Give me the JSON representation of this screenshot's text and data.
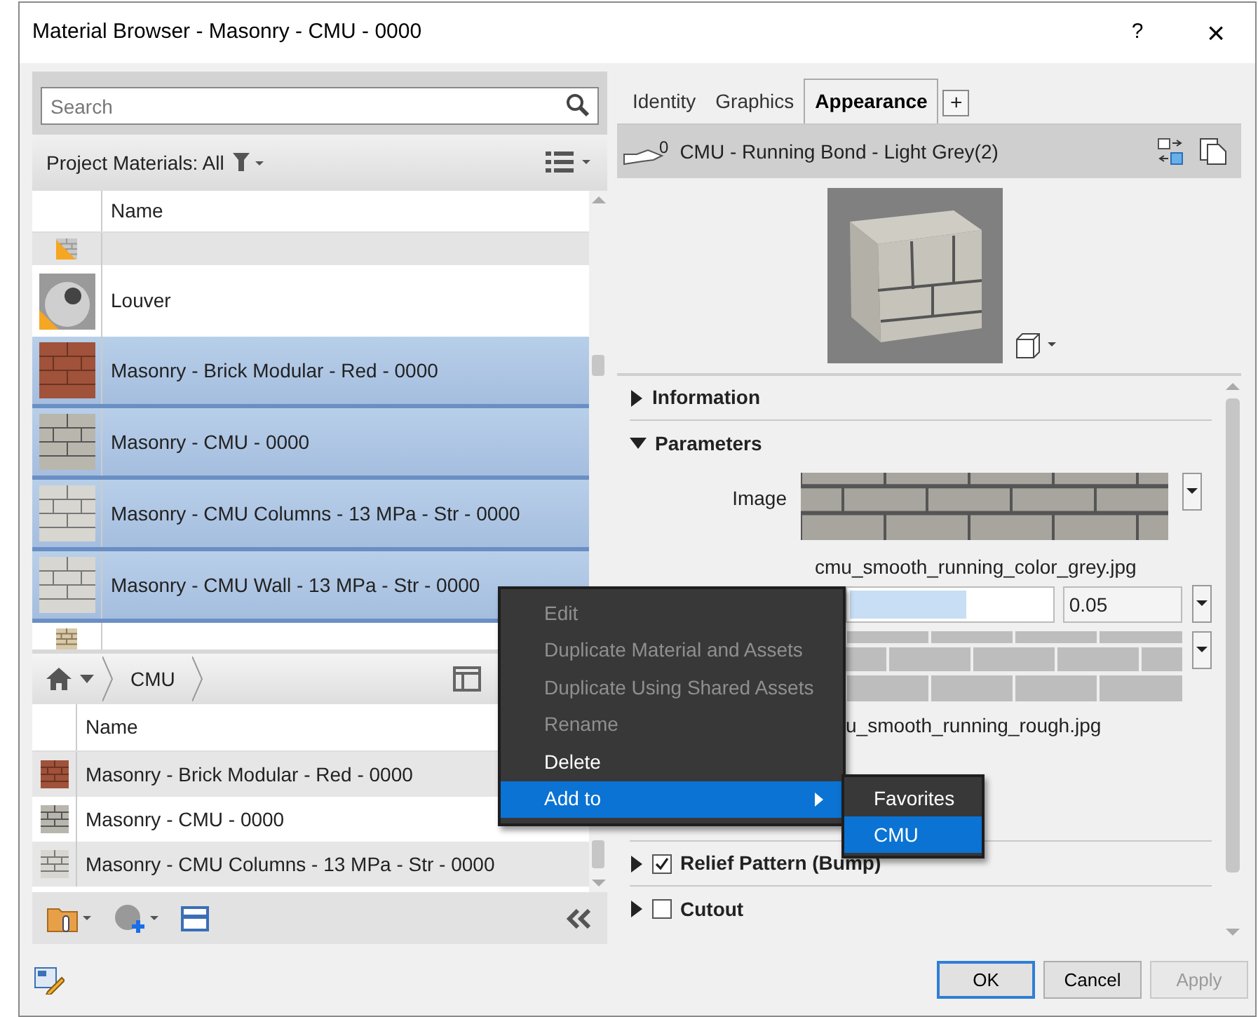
{
  "window": {
    "title": "Material Browser - Masonry - CMU - 0000",
    "help": "?",
    "close": "×"
  },
  "search": {
    "placeholder": "Search"
  },
  "filter": {
    "label": "Project Materials: All"
  },
  "project_list": {
    "columns": [
      "Name"
    ],
    "rows": [
      {
        "kind": "linoleum",
        "warning": true,
        "selected": false
      },
      {
        "name": "Louver",
        "kind": "sphere",
        "warning": true,
        "selected": false
      },
      {
        "name": "Masonry - Brick Modular - Red - 0000",
        "kind": "brick",
        "warning": false,
        "selected": true
      },
      {
        "name": "Masonry - CMU - 0000",
        "kind": "cmu",
        "warning": false,
        "selected": true
      },
      {
        "name": "Masonry - CMU Columns - 13 MPa - Str - 0000",
        "kind": "cmu-light",
        "warning": false,
        "selected": true
      },
      {
        "name": "Masonry - CMU Wall - 13 MPa - Str - 0000",
        "kind": "cmu-light",
        "warning": false,
        "selected": true
      },
      {
        "kind": "wood",
        "warning": false,
        "selected": false
      }
    ]
  },
  "library": {
    "breadcrumb": [
      "CMU"
    ],
    "columns": [
      "Name"
    ],
    "rows": [
      {
        "name": "Masonry - Brick Modular - Red - 0000",
        "kind": "brick"
      },
      {
        "name": "Masonry - CMU - 0000",
        "kind": "cmu"
      },
      {
        "name": "Masonry - CMU Columns - 13 MPa - Str - 0000",
        "kind": "cmu-light"
      }
    ]
  },
  "tabs": [
    {
      "label": "Identity",
      "selected": false
    },
    {
      "label": "Graphics",
      "selected": false
    },
    {
      "label": "Appearance",
      "selected": true
    }
  ],
  "add_tab": "+",
  "asset": {
    "name": "CMU - Running Bond - Light Grey(2)",
    "users": "0"
  },
  "sections_top": [
    {
      "label": "Information",
      "expanded": false
    },
    {
      "label": "Parameters",
      "expanded": true
    }
  ],
  "parameters": {
    "image_label": "Image",
    "image_file": "cmu_smooth_running_color_grey.jpg",
    "slider": {
      "level": 0.58,
      "value": "0.05"
    },
    "second_file": "u_smooth_running_rough.jpg"
  },
  "sections_bottom": [
    {
      "label": "Relief Pattern (Bump)",
      "expanded": false,
      "checked": true
    },
    {
      "label": "Cutout",
      "expanded": false,
      "checked": false
    }
  ],
  "context_menu": {
    "items": [
      {
        "label": "Edit",
        "disabled": true,
        "selected": false,
        "submenu": false
      },
      {
        "label": "Duplicate Material and Assets",
        "disabled": true,
        "selected": false,
        "submenu": false
      },
      {
        "label": "Duplicate Using Shared Assets",
        "disabled": true,
        "selected": false,
        "submenu": false
      },
      {
        "label": "Rename",
        "disabled": true,
        "selected": false,
        "submenu": false
      },
      {
        "label": "Delete",
        "disabled": false,
        "selected": false,
        "submenu": false
      },
      {
        "label": "Add to",
        "disabled": false,
        "selected": true,
        "submenu": true
      }
    ],
    "submenu": [
      {
        "label": "Favorites",
        "selected": false
      },
      {
        "label": "CMU",
        "selected": true
      }
    ]
  },
  "buttons": [
    {
      "label": "OK",
      "kind": "default",
      "disabled": false
    },
    {
      "label": "Cancel",
      "kind": "normal",
      "disabled": false
    },
    {
      "label": "Apply",
      "kind": "normal",
      "disabled": true
    }
  ]
}
